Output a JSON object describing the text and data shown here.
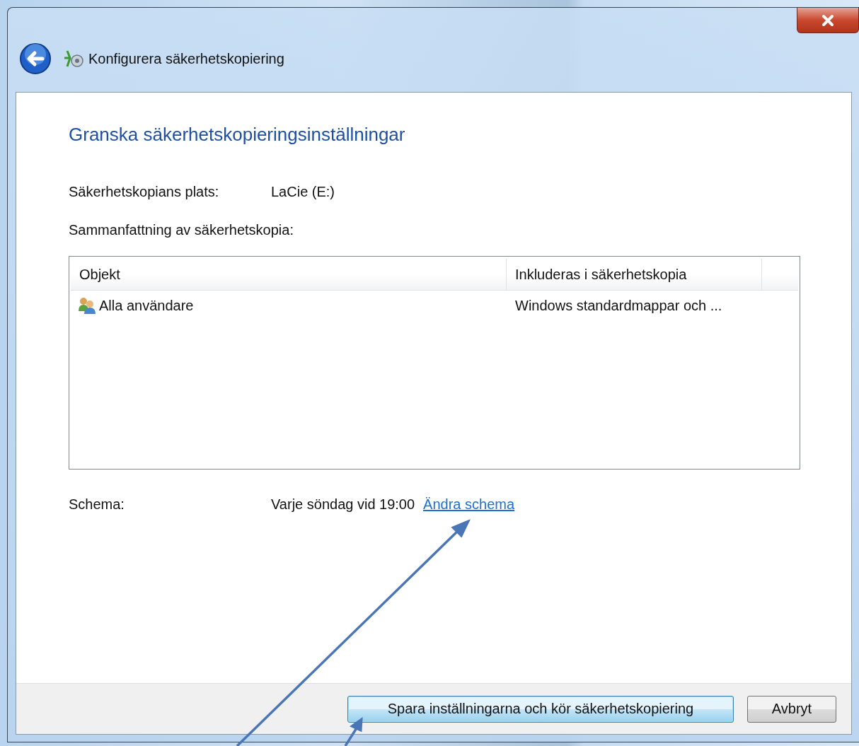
{
  "window": {
    "title": "Konfigurera säkerhetskopiering"
  },
  "heading": "Granska säkerhetskopieringsinställningar",
  "location": {
    "label": "Säkerhetskopians plats:",
    "value": "LaCie (E:)"
  },
  "summary_label": "Sammanfattning av säkerhetskopia:",
  "table": {
    "columns": [
      "Objekt",
      "Inkluderas i säkerhetskopia"
    ],
    "rows": [
      {
        "item": "Alla användare",
        "included": "Windows standardmappar och ..."
      }
    ]
  },
  "schedule": {
    "label": "Schema:",
    "value": "Varje söndag vid 19:00",
    "link": "Ändra schema"
  },
  "buttons": [
    {
      "label": "Spara inställningarna och kör säkerhetskopiering",
      "default": true
    },
    {
      "label": "Avbryt",
      "default": false
    }
  ]
}
